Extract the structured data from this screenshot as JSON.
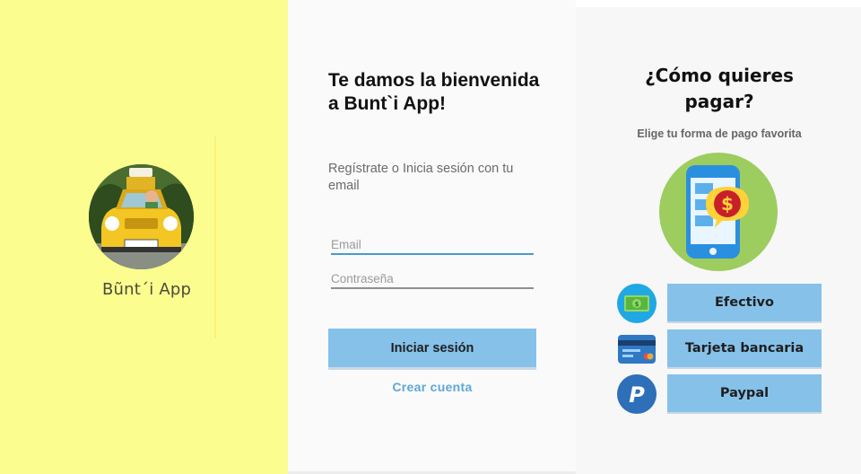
{
  "splash": {
    "app_name": "Bũnt´i App",
    "logo_icon": "taxi-logo-icon"
  },
  "login": {
    "title": "Te damos la bienvenida a Bunt`i App!",
    "subtitle": "Regístrate o Inicia sesión con tu email",
    "email_placeholder": "Email",
    "password_placeholder": "Contraseña",
    "login_button": "Iniciar sesión",
    "create_account_link": "Crear cuenta",
    "accent_color": "#86c1ea"
  },
  "payment": {
    "title": "¿Cómo quieres pagar?",
    "subtitle": "Elige tu forma de pago favorita",
    "illustration_icon": "phone-dollar-icon",
    "options": [
      {
        "label": "Efectivo",
        "icon": "cash-icon"
      },
      {
        "label": "Tarjeta bancaria",
        "icon": "credit-card-icon"
      },
      {
        "label": "Paypal",
        "icon": "paypal-icon"
      }
    ]
  },
  "colors": {
    "splash_bg": "#fbfe8f",
    "button_bg": "#86c1ea",
    "link": "#5ea8d6"
  }
}
